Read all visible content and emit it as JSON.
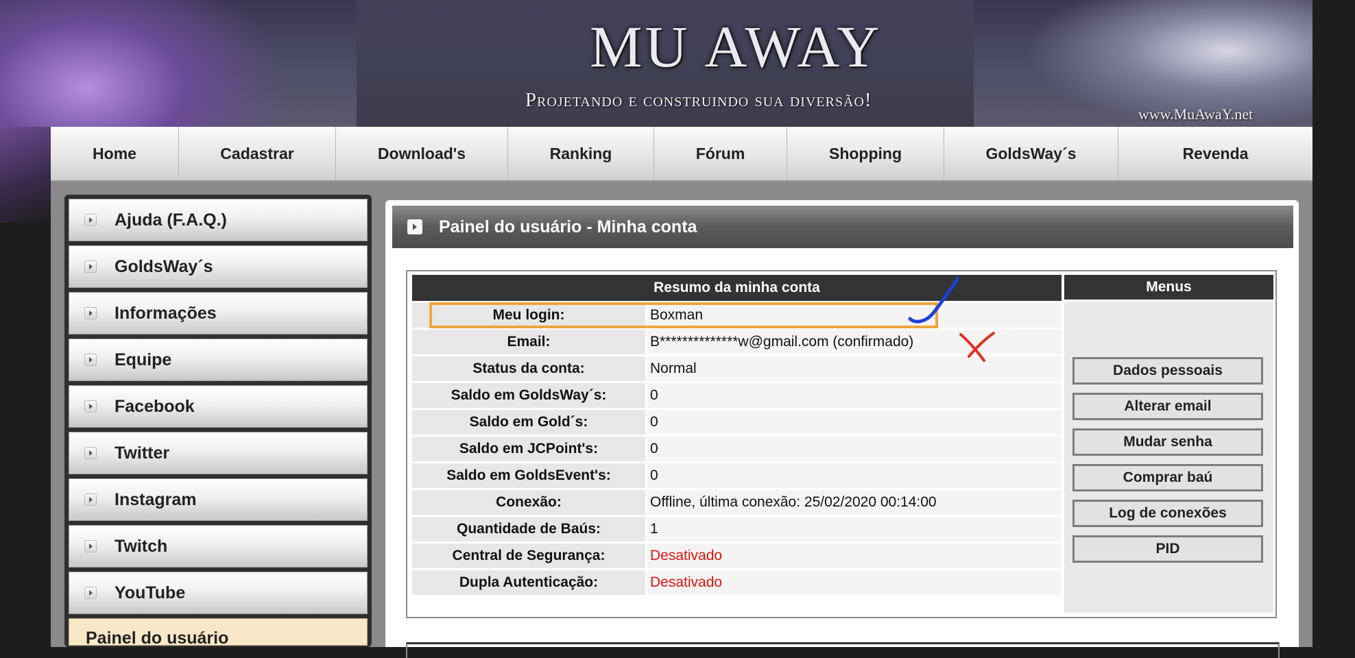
{
  "banner": {
    "logo_text": "MU AWAY",
    "slogan": "Projetando e construindo sua diversão!",
    "site_url": "www.MuAwaY.net"
  },
  "topnav": [
    {
      "label": "Home"
    },
    {
      "label": "Cadastrar"
    },
    {
      "label": "Download's"
    },
    {
      "label": "Ranking"
    },
    {
      "label": "Fórum"
    },
    {
      "label": "Shopping"
    },
    {
      "label": "GoldsWay´s"
    },
    {
      "label": "Revenda"
    }
  ],
  "sidebar": {
    "items": [
      {
        "label": "Ajuda (F.A.Q.)"
      },
      {
        "label": "GoldsWay´s"
      },
      {
        "label": "Informações"
      },
      {
        "label": "Equipe"
      },
      {
        "label": "Facebook"
      },
      {
        "label": "Twitter"
      },
      {
        "label": "Instagram"
      },
      {
        "label": "Twitch"
      },
      {
        "label": "YouTube"
      }
    ],
    "next_panel_title": "Painel do usuário"
  },
  "panel": {
    "title": "Painel do usuário - Minha conta",
    "summary_header": "Resumo da minha conta",
    "menus_header": "Menus",
    "rows": [
      {
        "label": "Meu login:",
        "value": "Boxman"
      },
      {
        "label": "Email:",
        "value": "B**************w@gmail.com (confirmado)"
      },
      {
        "label": "Status da conta:",
        "value": "Normal"
      },
      {
        "label": "Saldo em GoldsWay´s:",
        "value": "0"
      },
      {
        "label": "Saldo em Gold´s:",
        "value": "0"
      },
      {
        "label": "Saldo em JCPoint's:",
        "value": "0"
      },
      {
        "label": "Saldo em GoldsEvent's:",
        "value": "0"
      },
      {
        "label": "Conexão:",
        "value": "Offline, última conexão: 25/02/2020 00:14:00"
      },
      {
        "label": "Quantidade de Baús:",
        "value": "1"
      },
      {
        "label": "Central de Segurança:",
        "value": "Desativado"
      },
      {
        "label": "Dupla Autenticação:",
        "value": "Desativado"
      }
    ],
    "menu_buttons": [
      {
        "label": "Dados pessoais"
      },
      {
        "label": "Alterar email"
      },
      {
        "label": "Mudar senha"
      },
      {
        "label": "Comprar baú"
      },
      {
        "label": "Log de conexões"
      },
      {
        "label": "PID"
      }
    ]
  },
  "colors": {
    "disabled_status": "#e0140f",
    "highlight_box": "#f0a43c",
    "checkmark": "#1f3fd6",
    "xmark": "#e0301e"
  }
}
